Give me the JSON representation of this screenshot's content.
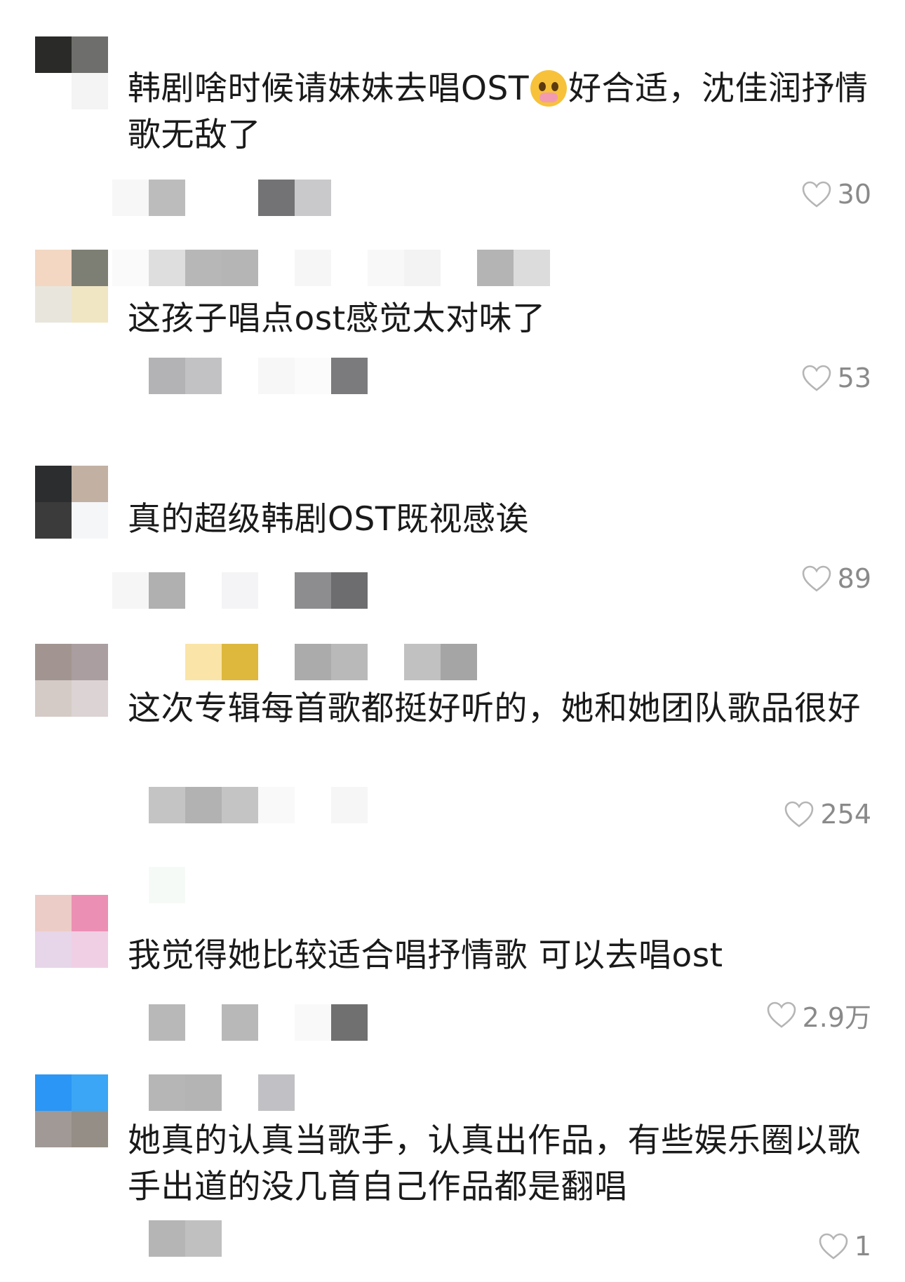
{
  "comments": [
    {
      "avatar_colors": [
        "#2a2a28",
        "#6e6f6c",
        "#ffffff",
        "#f4f4f4"
      ],
      "name_colors": [],
      "text_before": "韩剧啥时候请妹妹去唱OST",
      "emoji": "crying-face-icon",
      "text_after": "好合适，沈佳润抒情歌无敌了",
      "meta_colors": [
        "#f7f7f7",
        "#bcbcbc",
        "#ffffff",
        "#ffffff",
        "#737375",
        "#c9c9cb"
      ],
      "likes": "30"
    },
    {
      "avatar_colors": [
        "#f3d7c2",
        "#7d7f74",
        "#e8e6dc",
        "#f0e6c4"
      ],
      "name_colors": [
        "#fafafa",
        "#dedede",
        "#b7b7b7",
        "#b5b5b5",
        "#ffffff",
        "#f6f6f6",
        "#ffffff",
        "#f8f8f8",
        "#f3f3f3",
        "#ffffff",
        "#b4b4b4",
        "#dcdcdc"
      ],
      "text_before": "这孩子唱点ost感觉太对味了",
      "emoji": "",
      "text_after": "",
      "meta_colors": [
        "#ffffff",
        "#b3b3b5",
        "#c2c2c4",
        "#ffffff",
        "#f7f7f7",
        "#fbfbfb",
        "#7b7b7d"
      ],
      "likes": "53"
    },
    {
      "avatar_colors": [
        "#2b2d2f",
        "#c2b1a3",
        "#3b3b3b",
        "#f5f6f8"
      ],
      "name_colors": [],
      "text_before": "真的超级韩剧OST既视感诶",
      "emoji": "",
      "text_after": "",
      "meta_colors": [
        "#f6f6f6",
        "#b0b0b0",
        "#ffffff",
        "#f4f4f6",
        "#ffffff",
        "#8d8d8f",
        "#6d6d6f"
      ],
      "likes": "89"
    },
    {
      "avatar_colors": [
        "#a29591",
        "#ab9ea0",
        "#d4cbc6",
        "#dcd3d4"
      ],
      "name_colors": [
        "#ffffff",
        "#ffffff",
        "#fbe4a7",
        "#ddb83c",
        "#ffffff",
        "#ababab",
        "#b9b9b9",
        "#ffffff",
        "#c1c1c1",
        "#a5a5a5"
      ],
      "text_before": "这次专辑每首歌都挺好听的，她和她团队歌品很好",
      "emoji": "",
      "text_after": "",
      "meta_colors": [
        "#ffffff",
        "#c4c4c4",
        "#b2b2b2",
        "#c4c4c4",
        "#f9f9f9",
        "#ffffff",
        "#f6f6f6"
      ],
      "likes": "254"
    },
    {
      "avatar_colors": [
        "#ecccc7",
        "#ec8fb4",
        "#e7d5e9",
        "#f0cfe4"
      ],
      "name_colors": [
        "#ffffff",
        "#f6faf6",
        "#ffffff"
      ],
      "text_before": "我觉得她比较适合唱抒情歌 可以去唱ost",
      "emoji": "",
      "text_after": "",
      "meta_colors": [
        "#ffffff",
        "#b8b8b8",
        "#ffffff",
        "#b8b8b8",
        "#ffffff",
        "#f9f9f9",
        "#707070"
      ],
      "likes": "2.9万"
    },
    {
      "avatar_colors": [
        "#2b96f5",
        "#3aa6f5",
        "#a09995",
        "#958e86"
      ],
      "name_colors": [
        "#ffffff",
        "#b6b6b6",
        "#b4b4b4",
        "#ffffff",
        "#c1c1c5"
      ],
      "text_before": "她真的认真当歌手，认真出作品，有些娱乐圈以歌手出道的没几首自己作品都是翻唱",
      "emoji": "",
      "text_after": "",
      "meta_colors": [
        "#ffffff",
        "#b5b5b5",
        "#c0c0c0"
      ],
      "likes": "1"
    }
  ]
}
